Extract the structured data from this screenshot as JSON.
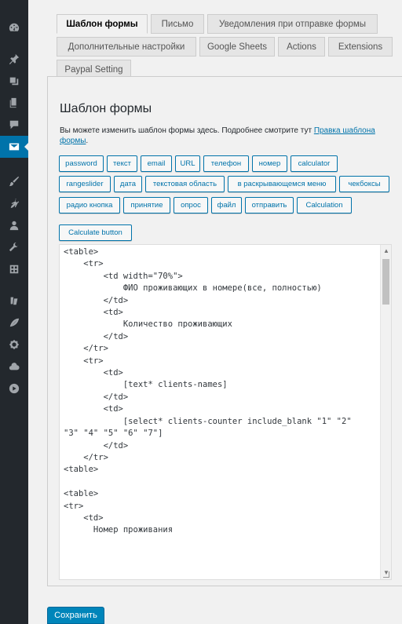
{
  "sidebar": {
    "icons": [
      "dashboard-icon",
      "pin-icon",
      "media-icon",
      "pages-icon",
      "comments-icon",
      "mail-icon",
      "appearance-icon",
      "plugins-icon",
      "users-icon",
      "tools-icon",
      "settings-icon",
      "seo-icon",
      "plugin-leaf-icon",
      "plugin-badge-icon",
      "cloud-icon",
      "play-icon"
    ],
    "active": "mail-icon"
  },
  "tabs": [
    {
      "label": "Шаблон формы",
      "active": true
    },
    {
      "label": "Письмо"
    },
    {
      "label": "Уведомления при отправке формы"
    },
    {
      "label": "Дополнительные настройки"
    },
    {
      "label": "Google Sheets"
    },
    {
      "label": "Actions"
    },
    {
      "label": "Extensions"
    },
    {
      "label": "Paypal Setting"
    }
  ],
  "panel": {
    "title": "Шаблон формы",
    "description": "Вы можете изменить шаблон формы здесь. Подробнее смотрите тут",
    "link_text": "Правка шаблона формы",
    "link_suffix": "."
  },
  "tag_buttons": [
    "password",
    "текст",
    "email",
    "URL",
    "телефон",
    "номер",
    "calculator",
    "rangeslider",
    "дата",
    "текстовая область",
    "в раскрывающемся меню",
    "чекбоксы",
    "радио кнопка",
    "принятие",
    "опрос",
    "файл",
    "отправить",
    "Calculation",
    "Calculate button"
  ],
  "code_text": "<table>\n    <tr>\n        <td width=\"70%\">\n            ФИО проживающих в номере(все, полностью)\n        </td>\n        <td>\n            Количество проживающих\n        </td>\n    </tr>\n    <tr>\n        <td>\n            [text* clients-names]\n        </td>\n        <td>\n            [select* clients-counter include_blank \"1\" \"2\"\n\"3\" \"4\" \"5\" \"6\" \"7\"]\n        </td>\n    </tr>\n<table>\n\n<table>\n<tr>\n    <td>\n      Номер проживания",
  "save_label": "Сохранить",
  "colors": {
    "accent": "#0073aa",
    "sidebar": "#23282d",
    "save": "#0085ba"
  }
}
